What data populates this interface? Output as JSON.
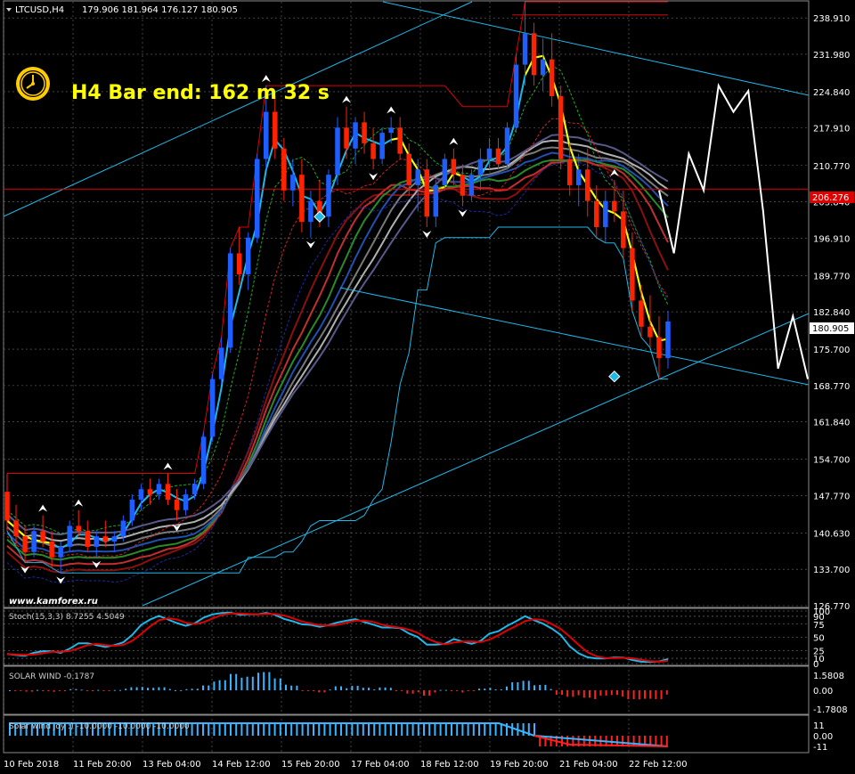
{
  "header": {
    "symbol": "LTCUSD,H4",
    "ohlc": "179.906 181.964 176.127 180.905",
    "timer": "H4 Bar end: 162 m 32 s",
    "watermark": "www.kamforex.ru"
  },
  "colors": {
    "background": "#000000",
    "grid": "#6e6e6e",
    "bull": "#1e5eff",
    "bear": "#ff2200",
    "cyan": "#1fb8e8",
    "yellow": "#ffff00",
    "white": "#ffffff",
    "red": "#e00000"
  },
  "price_panel": {
    "ticks": [
      "238.910",
      "231.980",
      "224.840",
      "217.910",
      "210.770",
      "203.840",
      "196.910",
      "189.770",
      "182.840",
      "175.700",
      "168.770",
      "161.840",
      "154.700",
      "147.770",
      "140.630",
      "133.700",
      "126.770"
    ],
    "hline_label": "206.276",
    "current_label": "180.905"
  },
  "time_axis": [
    "10 Feb 2018",
    "11 Feb 20:00",
    "13 Feb 04:00",
    "14 Feb 12:00",
    "15 Feb 20:00",
    "17 Feb 04:00",
    "18 Feb 12:00",
    "19 Feb 20:00",
    "21 Feb 04:00",
    "22 Feb 12:00"
  ],
  "stoch_panel": {
    "label": "Stoch(15,3,3) 8.7255 4.5049",
    "ticks": [
      "100",
      "90",
      "75",
      "50",
      "25",
      "10",
      "0"
    ]
  },
  "solar_panel": {
    "label": "SOLAR WIND -0.1787",
    "ticks": [
      "1.5808",
      "0.00",
      "-1.7808"
    ]
  },
  "joy_panel": {
    "label": "Solar wind joy :) -10.0000 -10.0000 -10.0000",
    "ticks": [
      "11",
      "0.00",
      "-11"
    ]
  },
  "chart_data": {
    "type": "candlestick",
    "symbol": "LTCUSD",
    "timeframe": "H4",
    "ylim": [
      126.77,
      242.0
    ],
    "hline": 206.276,
    "last_price": 180.905,
    "candles": [
      [
        148.5,
        152,
        141,
        143
      ],
      [
        143,
        146,
        138,
        140
      ],
      [
        140,
        142,
        135,
        137
      ],
      [
        137,
        142,
        136,
        141
      ],
      [
        141,
        144,
        138,
        139
      ],
      [
        139,
        141,
        134,
        136
      ],
      [
        136,
        139,
        133,
        138
      ],
      [
        138,
        143,
        137,
        142
      ],
      [
        142,
        145,
        140,
        141
      ],
      [
        141,
        143,
        137,
        138
      ],
      [
        138,
        141,
        136,
        140
      ],
      [
        140,
        143,
        138,
        139
      ],
      [
        139,
        141,
        137,
        140
      ],
      [
        140,
        144,
        139,
        143
      ],
      [
        143,
        148,
        142,
        147
      ],
      [
        147,
        150,
        145,
        149
      ],
      [
        149,
        151,
        146,
        148
      ],
      [
        148,
        151,
        147,
        150
      ],
      [
        150,
        152,
        146,
        147
      ],
      [
        147,
        149,
        143,
        145
      ],
      [
        145,
        149,
        144,
        148
      ],
      [
        148,
        151,
        147,
        150
      ],
      [
        150,
        160,
        149,
        159
      ],
      [
        159,
        171,
        158,
        170
      ],
      [
        170,
        178,
        169,
        176
      ],
      [
        176,
        195,
        175,
        194
      ],
      [
        194,
        199,
        188,
        190
      ],
      [
        190,
        198,
        187,
        197
      ],
      [
        197,
        213,
        196,
        212
      ],
      [
        212,
        226,
        210,
        221
      ],
      [
        221,
        224,
        212,
        214
      ],
      [
        214,
        216,
        204,
        206
      ],
      [
        206,
        212,
        203,
        209
      ],
      [
        209,
        212,
        198,
        200
      ],
      [
        200,
        206,
        197,
        204
      ],
      [
        204,
        208,
        199,
        201
      ],
      [
        201,
        210,
        199,
        209
      ],
      [
        209,
        220,
        207,
        218
      ],
      [
        218,
        222,
        212,
        214
      ],
      [
        214,
        220,
        211,
        219
      ],
      [
        219,
        221,
        213,
        215
      ],
      [
        215,
        218,
        210,
        212
      ],
      [
        212,
        218,
        211,
        217
      ],
      [
        217,
        220,
        215,
        218
      ],
      [
        218,
        220,
        212,
        213
      ],
      [
        213,
        215,
        205,
        207
      ],
      [
        207,
        212,
        202,
        210
      ],
      [
        210,
        212,
        199,
        201
      ],
      [
        201,
        208,
        199,
        207
      ],
      [
        207,
        213,
        206,
        212
      ],
      [
        212,
        214,
        207,
        209
      ],
      [
        209,
        211,
        203,
        205
      ],
      [
        205,
        210,
        204,
        209
      ],
      [
        209,
        214,
        206,
        212
      ],
      [
        212,
        216,
        210,
        214
      ],
      [
        214,
        216,
        210,
        211
      ],
      [
        211,
        219,
        210,
        218
      ],
      [
        218,
        232,
        217,
        230
      ],
      [
        230,
        242,
        226,
        236
      ],
      [
        236,
        238,
        226,
        228
      ],
      [
        228,
        235,
        225,
        231
      ],
      [
        231,
        236,
        222,
        224
      ],
      [
        224,
        226,
        210,
        212
      ],
      [
        212,
        215,
        205,
        207
      ],
      [
        207,
        213,
        203,
        210
      ],
      [
        210,
        214,
        201,
        204
      ],
      [
        204,
        207,
        197,
        199
      ],
      [
        199,
        206,
        196,
        204
      ],
      [
        204,
        208,
        200,
        202
      ],
      [
        202,
        206,
        193,
        195
      ],
      [
        195,
        198,
        183,
        185
      ],
      [
        185,
        188,
        178,
        180
      ],
      [
        180,
        186,
        176,
        178
      ],
      [
        178,
        182,
        170,
        174
      ],
      [
        174,
        183,
        172,
        181
      ]
    ],
    "yellow_ma_last": 176.0,
    "forecast_path": [
      206,
      194,
      213,
      206,
      226,
      221,
      225,
      202,
      172,
      182,
      170
    ]
  }
}
